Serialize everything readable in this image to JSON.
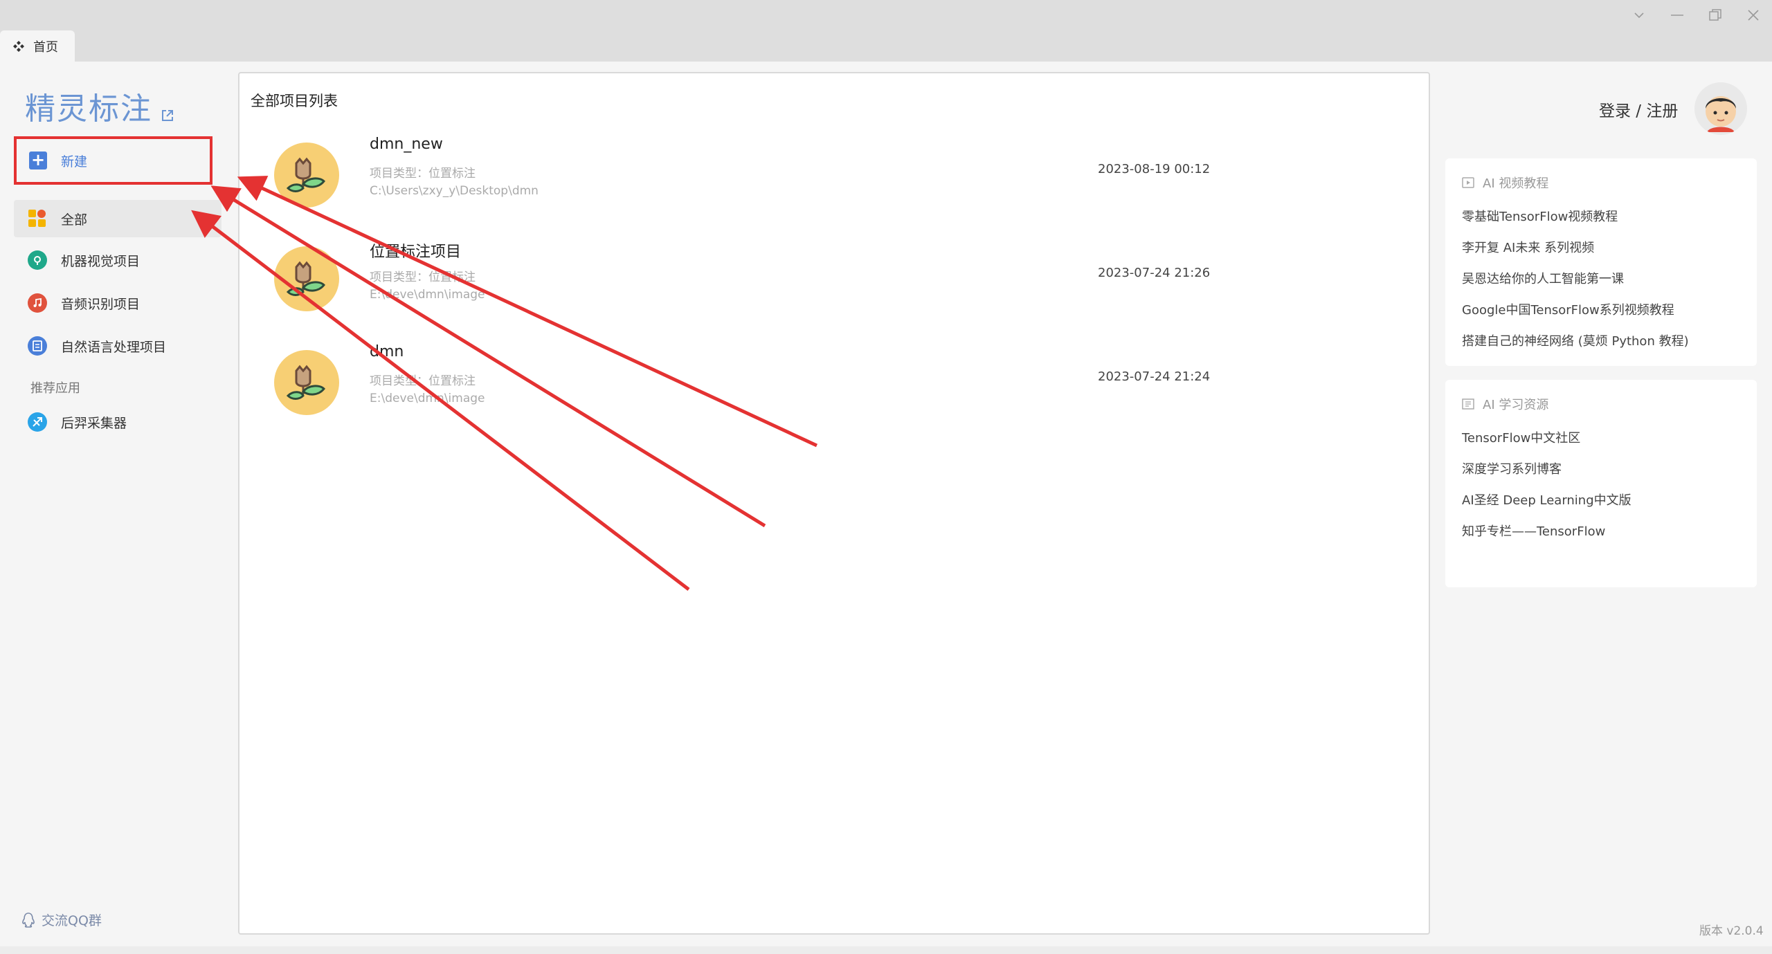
{
  "tab": {
    "label": "首页"
  },
  "sidebar": {
    "brand": "精灵标注",
    "new_label": "新建",
    "nav": [
      {
        "label": "全部"
      },
      {
        "label": "机器视觉项目"
      },
      {
        "label": "音频识别项目"
      },
      {
        "label": "自然语言处理项目"
      }
    ],
    "section_label": "推荐应用",
    "apps": [
      {
        "label": "后羿采集器"
      }
    ],
    "qq_group": "交流QQ群"
  },
  "main": {
    "title": "全部项目列表",
    "projects": [
      {
        "name": "dmn_new",
        "type": "项目类型：位置标注",
        "path": "C:\\Users\\zxy_y\\Desktop\\dmn",
        "date": "2023-08-19 00:12"
      },
      {
        "name": "位置标注项目",
        "type": "项目类型：位置标注",
        "path": "E:\\deve\\dmn\\image",
        "date": "2023-07-24 21:26"
      },
      {
        "name": "dmn",
        "type": "项目类型：位置标注",
        "path": "E:\\deve\\dmn\\image",
        "date": "2023-07-24 21:24"
      }
    ]
  },
  "right": {
    "login": "登录 / 注册",
    "video_card": {
      "title": "AI 视频教程",
      "links": [
        "零基础TensorFlow视频教程",
        "李开复 AI未来 系列视频",
        "吴恩达给你的人工智能第一课",
        "Google中国TensorFlow系列视频教程",
        "搭建自己的神经网络 (莫烦 Python 教程)"
      ]
    },
    "resource_card": {
      "title": "AI 学习资源",
      "links": [
        "TensorFlow中文社区",
        "深度学习系列博客",
        "AI圣经 Deep Learning中文版",
        "知乎专栏——TensorFlow"
      ]
    }
  },
  "version": "版本 v2.0.4",
  "colors": {
    "accent": "#4a7fd9",
    "annotation": "#e43232",
    "avatar_bg": "#f7cf74"
  }
}
